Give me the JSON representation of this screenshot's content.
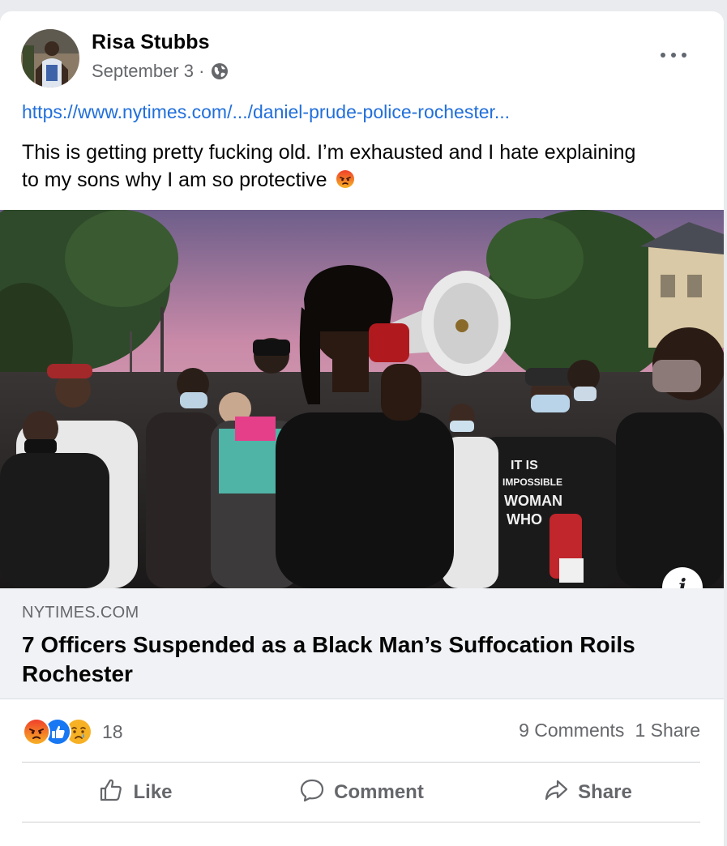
{
  "post": {
    "author": "Risa Stubbs",
    "date": "September 3 ·",
    "privacy_icon": "globe-icon",
    "link_url": "https://www.nytimes.com/.../daniel-prude-police-rochester...",
    "text": "This is getting pretty fucking old. I’m exhausted and I hate explaining to my sons why I am so protective"
  },
  "link_preview": {
    "domain": "NYTIMES.COM",
    "headline": "7 Officers Suspended as a Black Man’s Suffocation Roils Rochester",
    "info_icon": "i"
  },
  "engagement": {
    "reaction_icons": [
      "angry-icon",
      "like-icon",
      "sad-icon"
    ],
    "reaction_count": "18",
    "comments": "9 Comments",
    "shares": "1 Share"
  },
  "actions": {
    "like": "Like",
    "comment": "Comment",
    "share": "Share"
  },
  "colors": {
    "link": "#216fdb",
    "secondary_text": "#65676b",
    "like_blue": "#1877f2",
    "angry_orange": "#e9710f"
  }
}
